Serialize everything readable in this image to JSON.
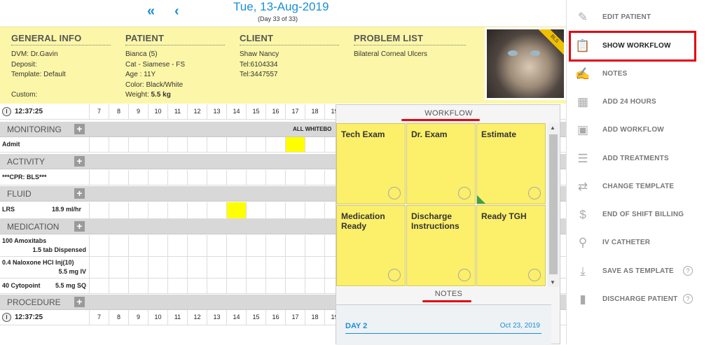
{
  "nav": {
    "prev_all": "«",
    "prev": "‹",
    "date": "Tue, 13-Aug-2019",
    "day": "(Day 33 of 33)"
  },
  "info": {
    "general": {
      "title": "GENERAL INFO",
      "lines": [
        "DVM: Dr.Gavin",
        "Deposit:",
        "Template: Default",
        "",
        "Custom:"
      ]
    },
    "patient": {
      "title": "PATIENT",
      "lines": [
        "Bianca (5)",
        "Cat - Siamese - FS",
        "Age : 11Y",
        "Color: Black/White"
      ],
      "weight_label": "Weight: ",
      "weight": "5.5 kg"
    },
    "client": {
      "title": "CLIENT",
      "lines": [
        "Shaw Nancy",
        "Tel:6104334",
        "Tel:3447557"
      ]
    },
    "problem": {
      "title": "PROBLEM LIST",
      "lines": [
        "Bilateral Corneal Ulcers"
      ]
    },
    "badge": "BLS"
  },
  "grid": {
    "time": "12:37:25",
    "hours": [
      "7",
      "8",
      "9",
      "10",
      "11",
      "12",
      "13",
      "14",
      "15",
      "16",
      "17",
      "18",
      "19"
    ],
    "sections": {
      "monitoring": "MONITORING",
      "activity": "ACTIVITY",
      "fluid": "FLUID",
      "medication": "MEDICATION",
      "procedure": "PROCEDURE"
    },
    "all_whiteboard": "ALL WHITEBO",
    "admit": "Admit",
    "cpr": "***CPR: BLS***",
    "lrs": "LRS",
    "lrs_rate": "18.9 ml/hr",
    "meds": [
      {
        "name": "100 Amoxitabs",
        "dose": "1.5 tab Dispensed"
      },
      {
        "name": "0.4 Naloxone HCl Inj(10)",
        "dose": "5.5 mg IV"
      },
      {
        "name": "40 Cytopoint",
        "dose": "5.5 mg SQ"
      }
    ],
    "time_bottom": "12:37:25"
  },
  "workflow": {
    "title": "WORKFLOW",
    "cards": [
      "Tech Exam",
      "Dr. Exam",
      "Estimate",
      "Medication Ready",
      "Discharge Instructions",
      "Ready TGH"
    ],
    "notes_title": "NOTES",
    "day": "DAY 2",
    "day_date": "Oct 23, 2019"
  },
  "menu": {
    "items": [
      "EDIT PATIENT",
      "SHOW WORKFLOW",
      "NOTES",
      "ADD 24 HOURS",
      "ADD WORKFLOW",
      "ADD TREATMENTS",
      "CHANGE TEMPLATE",
      "END OF SHIFT BILLING",
      "IV CATHETER",
      "SAVE AS TEMPLATE",
      "DISCHARGE PATIENT"
    ],
    "help": "?"
  },
  "colors": {
    "accent": "#1a8fd4",
    "highlight": "#e30613",
    "card": "#fcef6a",
    "info_bg": "#fcf7a8"
  }
}
